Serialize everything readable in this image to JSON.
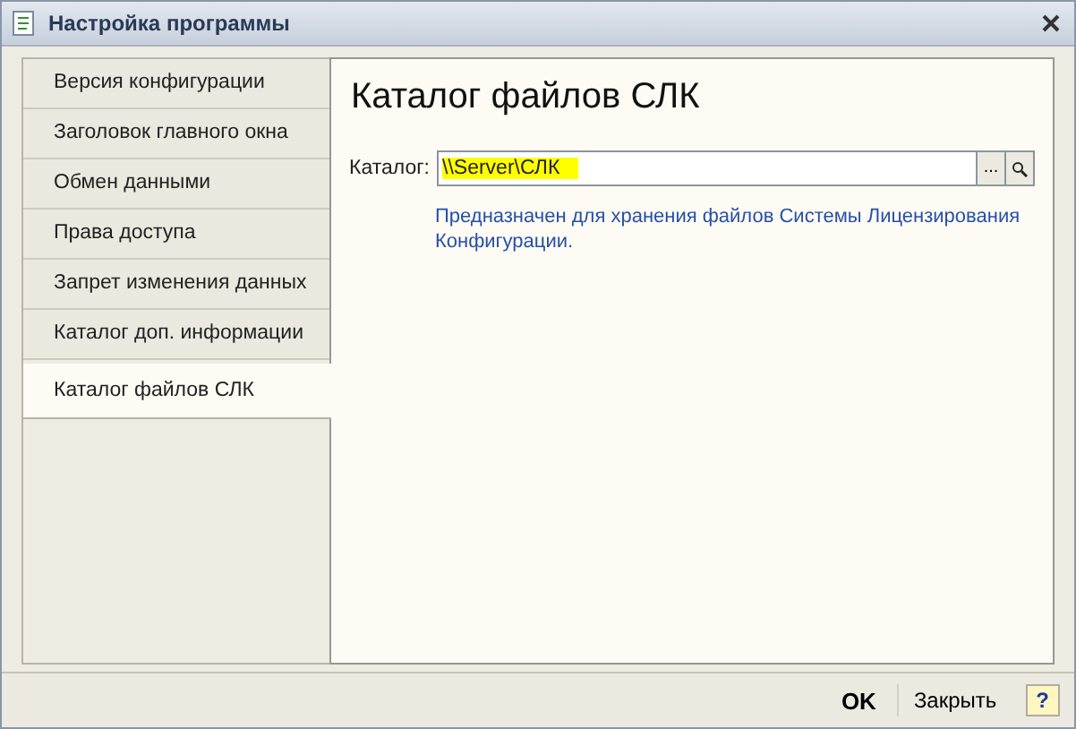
{
  "window": {
    "title": "Настройка программы"
  },
  "tabs": [
    {
      "label": "Версия конфигурации",
      "selected": false
    },
    {
      "label": "Заголовок главного окна",
      "selected": false
    },
    {
      "label": "Обмен данными",
      "selected": false
    },
    {
      "label": "Права доступа",
      "selected": false
    },
    {
      "label": "Запрет изменения данных",
      "selected": false
    },
    {
      "label": "Каталог доп. информации",
      "selected": false
    },
    {
      "label": "Каталог файлов СЛК",
      "selected": true
    }
  ],
  "content": {
    "heading": "Каталог файлов СЛК",
    "field": {
      "label": "Каталог:",
      "value": "\\\\Server\\СЛК",
      "highlighted": true,
      "choice_button": "..."
    },
    "hint": "Предназначен для хранения файлов Системы Лицензирования Конфигурации."
  },
  "footer": {
    "buttons": [
      {
        "label": "OK",
        "kind": "default"
      },
      {
        "label": "Закрыть",
        "kind": "normal"
      },
      {
        "label": "?",
        "kind": "help"
      }
    ]
  }
}
